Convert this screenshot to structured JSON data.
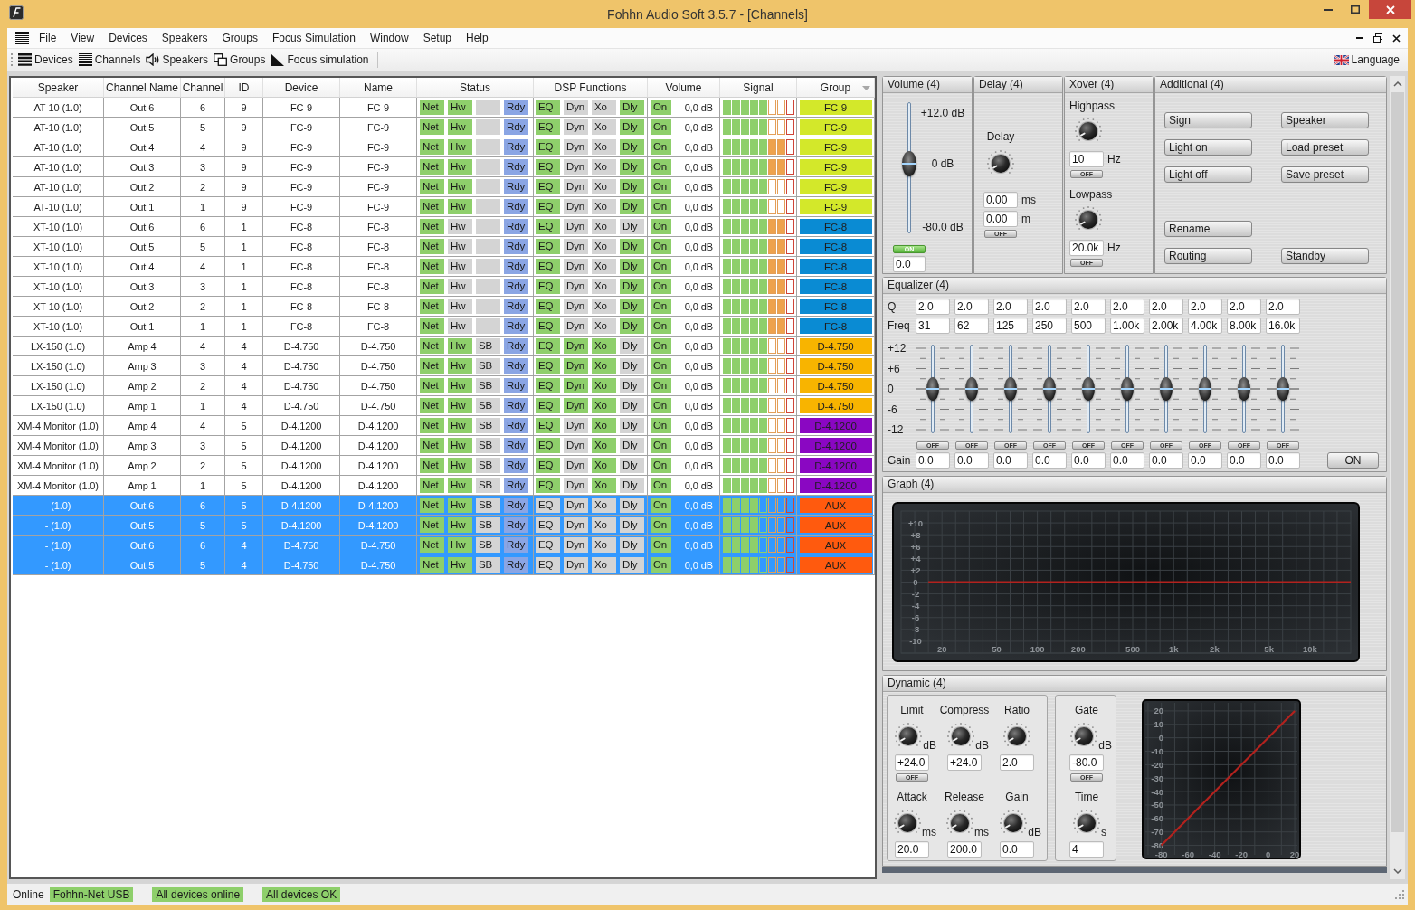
{
  "window": {
    "title": "Fohhn Audio Soft 3.5.7 - [Channels]"
  },
  "menu": {
    "items": [
      "File",
      "View",
      "Devices",
      "Speakers",
      "Groups",
      "Focus Simulation",
      "Window",
      "Setup",
      "Help"
    ]
  },
  "toolbar": {
    "items": [
      "Devices",
      "Channels",
      "Speakers",
      "Groups",
      "Focus simulation"
    ],
    "language": "Language"
  },
  "table": {
    "columns": [
      "Speaker",
      "Channel Name",
      "Channel",
      "ID",
      "Device",
      "Name",
      "Status",
      "DSP Functions",
      "Volume",
      "Signal",
      "Group"
    ],
    "rows": [
      {
        "speaker": "AT-10 (1.0)",
        "channel_name": "Out 6",
        "channel": "6",
        "id": "9",
        "device": "FC-9",
        "name": "FC-9",
        "status": [
          {
            "label": "Net",
            "on": true
          },
          {
            "label": "Hw",
            "on": true
          },
          {
            "on": false
          },
          {
            "label": "Rdy",
            "on": true
          }
        ],
        "dsp": [
          {
            "label": "EQ",
            "on": true
          },
          {
            "label": "Dyn",
            "on": false
          },
          {
            "label": "Xo",
            "on": false
          },
          {
            "label": "Dly",
            "on": true
          }
        ],
        "output": {
          "label": "On",
          "on": true
        },
        "volume": "0,0 dB",
        "signal": {
          "level": 0.625
        },
        "group": {
          "label": "FC-9",
          "color": "#d3e82a"
        },
        "selected": false
      },
      {
        "speaker": "AT-10 (1.0)",
        "channel_name": "Out 5",
        "channel": "5",
        "id": "9",
        "device": "FC-9",
        "name": "FC-9",
        "status": [
          {
            "label": "Net",
            "on": true
          },
          {
            "label": "Hw",
            "on": true
          },
          {
            "on": false
          },
          {
            "label": "Rdy",
            "on": true
          }
        ],
        "dsp": [
          {
            "label": "EQ",
            "on": true
          },
          {
            "label": "Dyn",
            "on": false
          },
          {
            "label": "Xo",
            "on": false
          },
          {
            "label": "Dly",
            "on": true
          }
        ],
        "output": {
          "label": "On",
          "on": true
        },
        "volume": "0,0 dB",
        "signal": {
          "level": 0.625
        },
        "group": {
          "label": "FC-9",
          "color": "#d3e82a"
        },
        "selected": false
      },
      {
        "speaker": "AT-10 (1.0)",
        "channel_name": "Out 4",
        "channel": "4",
        "id": "9",
        "device": "FC-9",
        "name": "FC-9",
        "status": [
          {
            "label": "Net",
            "on": true
          },
          {
            "label": "Hw",
            "on": true
          },
          {
            "on": false
          },
          {
            "label": "Rdy",
            "on": true
          }
        ],
        "dsp": [
          {
            "label": "EQ",
            "on": true
          },
          {
            "label": "Dyn",
            "on": false
          },
          {
            "label": "Xo",
            "on": false
          },
          {
            "label": "Dly",
            "on": true
          }
        ],
        "output": {
          "label": "On",
          "on": true
        },
        "volume": "0,0 dB",
        "signal": {
          "level": 0.875
        },
        "group": {
          "label": "FC-9",
          "color": "#d3e82a"
        },
        "selected": false
      },
      {
        "speaker": "AT-10 (1.0)",
        "channel_name": "Out 3",
        "channel": "3",
        "id": "9",
        "device": "FC-9",
        "name": "FC-9",
        "status": [
          {
            "label": "Net",
            "on": true
          },
          {
            "label": "Hw",
            "on": true
          },
          {
            "on": false
          },
          {
            "label": "Rdy",
            "on": true
          }
        ],
        "dsp": [
          {
            "label": "EQ",
            "on": true
          },
          {
            "label": "Dyn",
            "on": false
          },
          {
            "label": "Xo",
            "on": false
          },
          {
            "label": "Dly",
            "on": true
          }
        ],
        "output": {
          "label": "On",
          "on": true
        },
        "volume": "0,0 dB",
        "signal": {
          "level": 0.875
        },
        "group": {
          "label": "FC-9",
          "color": "#d3e82a"
        },
        "selected": false
      },
      {
        "speaker": "AT-10 (1.0)",
        "channel_name": "Out 2",
        "channel": "2",
        "id": "9",
        "device": "FC-9",
        "name": "FC-9",
        "status": [
          {
            "label": "Net",
            "on": true
          },
          {
            "label": "Hw",
            "on": true
          },
          {
            "on": false
          },
          {
            "label": "Rdy",
            "on": true
          }
        ],
        "dsp": [
          {
            "label": "EQ",
            "on": true
          },
          {
            "label": "Dyn",
            "on": false
          },
          {
            "label": "Xo",
            "on": false
          },
          {
            "label": "Dly",
            "on": true
          }
        ],
        "output": {
          "label": "On",
          "on": true
        },
        "volume": "0,0 dB",
        "signal": {
          "level": 0.625
        },
        "group": {
          "label": "FC-9",
          "color": "#d3e82a"
        },
        "selected": false
      },
      {
        "speaker": "AT-10 (1.0)",
        "channel_name": "Out 1",
        "channel": "1",
        "id": "9",
        "device": "FC-9",
        "name": "FC-9",
        "status": [
          {
            "label": "Net",
            "on": true
          },
          {
            "label": "Hw",
            "on": true
          },
          {
            "on": false
          },
          {
            "label": "Rdy",
            "on": true
          }
        ],
        "dsp": [
          {
            "label": "EQ",
            "on": true
          },
          {
            "label": "Dyn",
            "on": false
          },
          {
            "label": "Xo",
            "on": false
          },
          {
            "label": "Dly",
            "on": true
          }
        ],
        "output": {
          "label": "On",
          "on": true
        },
        "volume": "0,0 dB",
        "signal": {
          "level": 0.625
        },
        "group": {
          "label": "FC-9",
          "color": "#d3e82a"
        },
        "selected": false
      },
      {
        "speaker": "XT-10 (1.0)",
        "channel_name": "Out 6",
        "channel": "6",
        "id": "1",
        "device": "FC-8",
        "name": "FC-8",
        "status": [
          {
            "label": "Net",
            "on": true
          },
          {
            "label": "Hw",
            "on": false
          },
          {
            "on": false
          },
          {
            "label": "Rdy",
            "on": true
          }
        ],
        "dsp": [
          {
            "label": "EQ",
            "on": true
          },
          {
            "label": "Dyn",
            "on": false
          },
          {
            "label": "Xo",
            "on": false
          },
          {
            "label": "Dly",
            "on": false
          }
        ],
        "output": {
          "label": "On",
          "on": true
        },
        "volume": "0,0 dB",
        "signal": {
          "level": 0.875
        },
        "group": {
          "label": "FC-8",
          "color": "#0a8bd3"
        },
        "selected": false
      },
      {
        "speaker": "XT-10 (1.0)",
        "channel_name": "Out 5",
        "channel": "5",
        "id": "1",
        "device": "FC-8",
        "name": "FC-8",
        "status": [
          {
            "label": "Net",
            "on": true
          },
          {
            "label": "Hw",
            "on": false
          },
          {
            "on": false
          },
          {
            "label": "Rdy",
            "on": true
          }
        ],
        "dsp": [
          {
            "label": "EQ",
            "on": true
          },
          {
            "label": "Dyn",
            "on": false
          },
          {
            "label": "Xo",
            "on": false
          },
          {
            "label": "Dly",
            "on": true
          }
        ],
        "output": {
          "label": "On",
          "on": true
        },
        "volume": "0,0 dB",
        "signal": {
          "level": 0.875
        },
        "group": {
          "label": "FC-8",
          "color": "#0a8bd3"
        },
        "selected": false
      },
      {
        "speaker": "XT-10 (1.0)",
        "channel_name": "Out 4",
        "channel": "4",
        "id": "1",
        "device": "FC-8",
        "name": "FC-8",
        "status": [
          {
            "label": "Net",
            "on": true
          },
          {
            "label": "Hw",
            "on": false
          },
          {
            "on": false
          },
          {
            "label": "Rdy",
            "on": true
          }
        ],
        "dsp": [
          {
            "label": "EQ",
            "on": true
          },
          {
            "label": "Dyn",
            "on": false
          },
          {
            "label": "Xo",
            "on": false
          },
          {
            "label": "Dly",
            "on": true
          }
        ],
        "output": {
          "label": "On",
          "on": true
        },
        "volume": "0,0 dB",
        "signal": {
          "level": 0.875
        },
        "group": {
          "label": "FC-8",
          "color": "#0a8bd3"
        },
        "selected": false
      },
      {
        "speaker": "XT-10 (1.0)",
        "channel_name": "Out 3",
        "channel": "3",
        "id": "1",
        "device": "FC-8",
        "name": "FC-8",
        "status": [
          {
            "label": "Net",
            "on": true
          },
          {
            "label": "Hw",
            "on": false
          },
          {
            "on": false
          },
          {
            "label": "Rdy",
            "on": true
          }
        ],
        "dsp": [
          {
            "label": "EQ",
            "on": true
          },
          {
            "label": "Dyn",
            "on": false
          },
          {
            "label": "Xo",
            "on": false
          },
          {
            "label": "Dly",
            "on": true
          }
        ],
        "output": {
          "label": "On",
          "on": true
        },
        "volume": "0,0 dB",
        "signal": {
          "level": 0.875
        },
        "group": {
          "label": "FC-8",
          "color": "#0a8bd3"
        },
        "selected": false
      },
      {
        "speaker": "XT-10 (1.0)",
        "channel_name": "Out 2",
        "channel": "2",
        "id": "1",
        "device": "FC-8",
        "name": "FC-8",
        "status": [
          {
            "label": "Net",
            "on": true
          },
          {
            "label": "Hw",
            "on": false
          },
          {
            "on": false
          },
          {
            "label": "Rdy",
            "on": true
          }
        ],
        "dsp": [
          {
            "label": "EQ",
            "on": true
          },
          {
            "label": "Dyn",
            "on": false
          },
          {
            "label": "Xo",
            "on": false
          },
          {
            "label": "Dly",
            "on": true
          }
        ],
        "output": {
          "label": "On",
          "on": true
        },
        "volume": "0,0 dB",
        "signal": {
          "level": 0.875
        },
        "group": {
          "label": "FC-8",
          "color": "#0a8bd3"
        },
        "selected": false
      },
      {
        "speaker": "XT-10 (1.0)",
        "channel_name": "Out 1",
        "channel": "1",
        "id": "1",
        "device": "FC-8",
        "name": "FC-8",
        "status": [
          {
            "label": "Net",
            "on": true
          },
          {
            "label": "Hw",
            "on": false
          },
          {
            "on": false
          },
          {
            "label": "Rdy",
            "on": true
          }
        ],
        "dsp": [
          {
            "label": "EQ",
            "on": true
          },
          {
            "label": "Dyn",
            "on": false
          },
          {
            "label": "Xo",
            "on": false
          },
          {
            "label": "Dly",
            "on": true
          }
        ],
        "output": {
          "label": "On",
          "on": true
        },
        "volume": "0,0 dB",
        "signal": {
          "level": 0.875
        },
        "group": {
          "label": "FC-8",
          "color": "#0a8bd3"
        },
        "selected": false
      },
      {
        "speaker": "LX-150 (1.0)",
        "channel_name": "Amp 4",
        "channel": "4",
        "id": "4",
        "device": "D-4.750",
        "name": "D-4.750",
        "status": [
          {
            "label": "Net",
            "on": true
          },
          {
            "label": "Hw",
            "on": true
          },
          {
            "label": "SB",
            "on": false
          },
          {
            "label": "Rdy",
            "on": true
          }
        ],
        "dsp": [
          {
            "label": "EQ",
            "on": true
          },
          {
            "label": "Dyn",
            "on": true
          },
          {
            "label": "Xo",
            "on": true
          },
          {
            "label": "Dly",
            "on": false
          }
        ],
        "output": {
          "label": "On",
          "on": true
        },
        "volume": "0,0 dB",
        "signal": {
          "level": 0.625
        },
        "group": {
          "label": "D-4.750",
          "color": "#f8b400"
        },
        "selected": false
      },
      {
        "speaker": "LX-150 (1.0)",
        "channel_name": "Amp 3",
        "channel": "3",
        "id": "4",
        "device": "D-4.750",
        "name": "D-4.750",
        "status": [
          {
            "label": "Net",
            "on": true
          },
          {
            "label": "Hw",
            "on": true
          },
          {
            "label": "SB",
            "on": false
          },
          {
            "label": "Rdy",
            "on": true
          }
        ],
        "dsp": [
          {
            "label": "EQ",
            "on": true
          },
          {
            "label": "Dyn",
            "on": true
          },
          {
            "label": "Xo",
            "on": true
          },
          {
            "label": "Dly",
            "on": false
          }
        ],
        "output": {
          "label": "On",
          "on": true
        },
        "volume": "0,0 dB",
        "signal": {
          "level": 0.625
        },
        "group": {
          "label": "D-4.750",
          "color": "#f8b400"
        },
        "selected": false
      },
      {
        "speaker": "LX-150 (1.0)",
        "channel_name": "Amp 2",
        "channel": "2",
        "id": "4",
        "device": "D-4.750",
        "name": "D-4.750",
        "status": [
          {
            "label": "Net",
            "on": true
          },
          {
            "label": "Hw",
            "on": true
          },
          {
            "label": "SB",
            "on": false
          },
          {
            "label": "Rdy",
            "on": true
          }
        ],
        "dsp": [
          {
            "label": "EQ",
            "on": true
          },
          {
            "label": "Dyn",
            "on": true
          },
          {
            "label": "Xo",
            "on": true
          },
          {
            "label": "Dly",
            "on": false
          }
        ],
        "output": {
          "label": "On",
          "on": true
        },
        "volume": "0,0 dB",
        "signal": {
          "level": 0.625
        },
        "group": {
          "label": "D-4.750",
          "color": "#f8b400"
        },
        "selected": false
      },
      {
        "speaker": "LX-150 (1.0)",
        "channel_name": "Amp 1",
        "channel": "1",
        "id": "4",
        "device": "D-4.750",
        "name": "D-4.750",
        "status": [
          {
            "label": "Net",
            "on": true
          },
          {
            "label": "Hw",
            "on": true
          },
          {
            "label": "SB",
            "on": false
          },
          {
            "label": "Rdy",
            "on": true
          }
        ],
        "dsp": [
          {
            "label": "EQ",
            "on": true
          },
          {
            "label": "Dyn",
            "on": true
          },
          {
            "label": "Xo",
            "on": true
          },
          {
            "label": "Dly",
            "on": false
          }
        ],
        "output": {
          "label": "On",
          "on": true
        },
        "volume": "0,0 dB",
        "signal": {
          "level": 0.625
        },
        "group": {
          "label": "D-4.750",
          "color": "#f8b400"
        },
        "selected": false
      },
      {
        "speaker": "XM-4 Monitor (1.0)",
        "channel_name": "Amp 4",
        "channel": "4",
        "id": "5",
        "device": "D-4.1200",
        "name": "D-4.1200",
        "status": [
          {
            "label": "Net",
            "on": true
          },
          {
            "label": "Hw",
            "on": true
          },
          {
            "label": "SB",
            "on": false
          },
          {
            "label": "Rdy",
            "on": true
          }
        ],
        "dsp": [
          {
            "label": "EQ",
            "on": true
          },
          {
            "label": "Dyn",
            "on": false
          },
          {
            "label": "Xo",
            "on": true
          },
          {
            "label": "Dly",
            "on": false
          }
        ],
        "output": {
          "label": "On",
          "on": true
        },
        "volume": "0,0 dB",
        "signal": {
          "level": 0.625
        },
        "group": {
          "label": "D-4.1200",
          "color": "#8a07c2"
        },
        "selected": false
      },
      {
        "speaker": "XM-4 Monitor (1.0)",
        "channel_name": "Amp 3",
        "channel": "3",
        "id": "5",
        "device": "D-4.1200",
        "name": "D-4.1200",
        "status": [
          {
            "label": "Net",
            "on": true
          },
          {
            "label": "Hw",
            "on": true
          },
          {
            "label": "SB",
            "on": false
          },
          {
            "label": "Rdy",
            "on": true
          }
        ],
        "dsp": [
          {
            "label": "EQ",
            "on": true
          },
          {
            "label": "Dyn",
            "on": false
          },
          {
            "label": "Xo",
            "on": true
          },
          {
            "label": "Dly",
            "on": false
          }
        ],
        "output": {
          "label": "On",
          "on": true
        },
        "volume": "0,0 dB",
        "signal": {
          "level": 0.625
        },
        "group": {
          "label": "D-4.1200",
          "color": "#8a07c2"
        },
        "selected": false
      },
      {
        "speaker": "XM-4 Monitor (1.0)",
        "channel_name": "Amp 2",
        "channel": "2",
        "id": "5",
        "device": "D-4.1200",
        "name": "D-4.1200",
        "status": [
          {
            "label": "Net",
            "on": true
          },
          {
            "label": "Hw",
            "on": true
          },
          {
            "label": "SB",
            "on": false
          },
          {
            "label": "Rdy",
            "on": true
          }
        ],
        "dsp": [
          {
            "label": "EQ",
            "on": true
          },
          {
            "label": "Dyn",
            "on": false
          },
          {
            "label": "Xo",
            "on": true
          },
          {
            "label": "Dly",
            "on": false
          }
        ],
        "output": {
          "label": "On",
          "on": true
        },
        "volume": "0,0 dB",
        "signal": {
          "level": 0.625
        },
        "group": {
          "label": "D-4.1200",
          "color": "#8a07c2"
        },
        "selected": false
      },
      {
        "speaker": "XM-4 Monitor (1.0)",
        "channel_name": "Amp 1",
        "channel": "1",
        "id": "5",
        "device": "D-4.1200",
        "name": "D-4.1200",
        "status": [
          {
            "label": "Net",
            "on": true
          },
          {
            "label": "Hw",
            "on": true
          },
          {
            "label": "SB",
            "on": false
          },
          {
            "label": "Rdy",
            "on": true
          }
        ],
        "dsp": [
          {
            "label": "EQ",
            "on": true
          },
          {
            "label": "Dyn",
            "on": false
          },
          {
            "label": "Xo",
            "on": true
          },
          {
            "label": "Dly",
            "on": false
          }
        ],
        "output": {
          "label": "On",
          "on": true
        },
        "volume": "0,0 dB",
        "signal": {
          "level": 0.625
        },
        "group": {
          "label": "D-4.1200",
          "color": "#8a07c2"
        },
        "selected": false
      },
      {
        "speaker": "- (1.0)",
        "channel_name": "Out 6",
        "channel": "6",
        "id": "5",
        "device": "D-4.1200",
        "name": "D-4.1200",
        "status": [
          {
            "label": "Net",
            "on": true
          },
          {
            "label": "Hw",
            "on": true
          },
          {
            "label": "SB",
            "on": false
          },
          {
            "label": "Rdy",
            "on": true
          }
        ],
        "dsp": [
          {
            "label": "EQ",
            "on": false
          },
          {
            "label": "Dyn",
            "on": false
          },
          {
            "label": "Xo",
            "on": false
          },
          {
            "label": "Dly",
            "on": false
          }
        ],
        "output": {
          "label": "On",
          "on": true
        },
        "volume": "0,0 dB",
        "signal": {
          "level": 0.5
        },
        "group": {
          "label": "AUX",
          "color": "#ff5a0e"
        },
        "selected": true
      },
      {
        "speaker": "- (1.0)",
        "channel_name": "Out 5",
        "channel": "5",
        "id": "5",
        "device": "D-4.1200",
        "name": "D-4.1200",
        "status": [
          {
            "label": "Net",
            "on": true
          },
          {
            "label": "Hw",
            "on": true
          },
          {
            "label": "SB",
            "on": false
          },
          {
            "label": "Rdy",
            "on": true
          }
        ],
        "dsp": [
          {
            "label": "EQ",
            "on": false
          },
          {
            "label": "Dyn",
            "on": false
          },
          {
            "label": "Xo",
            "on": false
          },
          {
            "label": "Dly",
            "on": false
          }
        ],
        "output": {
          "label": "On",
          "on": true
        },
        "volume": "0,0 dB",
        "signal": {
          "level": 0.5
        },
        "group": {
          "label": "AUX",
          "color": "#ff5a0e"
        },
        "selected": true
      },
      {
        "speaker": "- (1.0)",
        "channel_name": "Out 6",
        "channel": "6",
        "id": "4",
        "device": "D-4.750",
        "name": "D-4.750",
        "status": [
          {
            "label": "Net",
            "on": true
          },
          {
            "label": "Hw",
            "on": true
          },
          {
            "label": "SB",
            "on": false
          },
          {
            "label": "Rdy",
            "on": true
          }
        ],
        "dsp": [
          {
            "label": "EQ",
            "on": false
          },
          {
            "label": "Dyn",
            "on": false
          },
          {
            "label": "Xo",
            "on": false
          },
          {
            "label": "Dly",
            "on": false
          }
        ],
        "output": {
          "label": "On",
          "on": true
        },
        "volume": "0,0 dB",
        "signal": {
          "level": 0.5
        },
        "group": {
          "label": "AUX",
          "color": "#ff5a0e"
        },
        "selected": true
      },
      {
        "speaker": "- (1.0)",
        "channel_name": "Out 5",
        "channel": "5",
        "id": "4",
        "device": "D-4.750",
        "name": "D-4.750",
        "status": [
          {
            "label": "Net",
            "on": true
          },
          {
            "label": "Hw",
            "on": true
          },
          {
            "label": "SB",
            "on": false
          },
          {
            "label": "Rdy",
            "on": true
          }
        ],
        "dsp": [
          {
            "label": "EQ",
            "on": false
          },
          {
            "label": "Dyn",
            "on": false
          },
          {
            "label": "Xo",
            "on": false
          },
          {
            "label": "Dly",
            "on": false
          }
        ],
        "output": {
          "label": "On",
          "on": true
        },
        "volume": "0,0 dB",
        "signal": {
          "level": 0.5
        },
        "group": {
          "label": "AUX",
          "color": "#ff5a0e"
        },
        "selected": true
      }
    ]
  },
  "volume_panel": {
    "title": "Volume (4)",
    "scale": [
      "+12.0 dB",
      "0 dB",
      "-80.0 dB"
    ],
    "level": 0.53,
    "toggle": {
      "label": "ON",
      "on": true
    },
    "value": "0.0"
  },
  "delay_panel": {
    "title": "Delay (4)",
    "label": "Delay",
    "fields": [
      {
        "value": "0.00",
        "unit": "ms"
      },
      {
        "value": "0.00",
        "unit": "m"
      }
    ],
    "toggle": {
      "label": "OFF",
      "on": false
    }
  },
  "xover_panel": {
    "title": "Xover (4)",
    "filters": [
      {
        "label": "Highpass",
        "value": "10",
        "unit": "Hz",
        "toggle": {
          "label": "OFF",
          "on": false
        }
      },
      {
        "label": "Lowpass",
        "value": "20.0k",
        "unit": "Hz",
        "toggle": {
          "label": "OFF",
          "on": false
        }
      }
    ]
  },
  "additional_panel": {
    "title": "Additional (4)",
    "button_groups": [
      [
        [
          "Sign",
          "Speaker"
        ],
        [
          "Light on",
          "Load preset"
        ],
        [
          "Light off",
          "Save preset"
        ]
      ],
      [
        [
          "Rename"
        ],
        [
          "Routing",
          "Standby"
        ]
      ]
    ]
  },
  "equalizer": {
    "title": "Equalizer (4)",
    "q_label": "Q",
    "freq_label": "Freq",
    "gain_label": "Gain",
    "scale": [
      "+12",
      "+6",
      "0",
      "-6",
      "-12"
    ],
    "bands": [
      {
        "q": "2.0",
        "freq": "31",
        "level": 0.5,
        "toggle": {
          "label": "OFF",
          "on": false
        },
        "gain": "0.0"
      },
      {
        "q": "2.0",
        "freq": "62",
        "level": 0.5,
        "toggle": {
          "label": "OFF",
          "on": false
        },
        "gain": "0.0"
      },
      {
        "q": "2.0",
        "freq": "125",
        "level": 0.5,
        "toggle": {
          "label": "OFF",
          "on": false
        },
        "gain": "0.0"
      },
      {
        "q": "2.0",
        "freq": "250",
        "level": 0.5,
        "toggle": {
          "label": "OFF",
          "on": false
        },
        "gain": "0.0"
      },
      {
        "q": "2.0",
        "freq": "500",
        "level": 0.5,
        "toggle": {
          "label": "OFF",
          "on": false
        },
        "gain": "0.0"
      },
      {
        "q": "2.0",
        "freq": "1.00k",
        "level": 0.5,
        "toggle": {
          "label": "OFF",
          "on": false
        },
        "gain": "0.0"
      },
      {
        "q": "2.0",
        "freq": "2.00k",
        "level": 0.5,
        "toggle": {
          "label": "OFF",
          "on": false
        },
        "gain": "0.0"
      },
      {
        "q": "2.0",
        "freq": "4.00k",
        "level": 0.5,
        "toggle": {
          "label": "OFF",
          "on": false
        },
        "gain": "0.0"
      },
      {
        "q": "2.0",
        "freq": "8.00k",
        "level": 0.5,
        "toggle": {
          "label": "OFF",
          "on": false
        },
        "gain": "0.0"
      },
      {
        "q": "2.0",
        "freq": "16.0k",
        "level": 0.5,
        "toggle": {
          "label": "OFF",
          "on": false
        },
        "gain": "0.0"
      }
    ],
    "button": "ON"
  },
  "graph": {
    "title": "Graph (4)",
    "chart_data": {
      "type": "line",
      "grid": true,
      "categories": [
        null,
        null,
        null,
        "20",
        null,
        null,
        null,
        "50",
        null,
        null,
        "100",
        null,
        null,
        "200",
        null,
        null,
        null,
        "500",
        null,
        null,
        "1k",
        null,
        null,
        "2k",
        null,
        null,
        null,
        "5k",
        null,
        null,
        "10k",
        null,
        null,
        null
      ],
      "ylim": [
        -12,
        12
      ],
      "yticks": [
        {
          "value": 10,
          "label": "+10"
        },
        {
          "value": 8,
          "label": "+8"
        },
        {
          "value": 6,
          "label": "+6"
        },
        {
          "value": 4,
          "label": "+4"
        },
        {
          "value": 2,
          "label": "+2"
        },
        0,
        -2,
        -4,
        -6,
        -8,
        -10
      ],
      "series": [
        {
          "color": "#b3221e",
          "values": [
            null,
            null,
            0,
            0,
            0,
            0,
            0,
            0,
            0,
            0,
            0,
            0,
            0,
            0,
            0,
            0,
            0,
            0,
            0,
            0,
            0,
            0,
            0,
            0,
            0,
            0,
            0,
            0,
            0,
            0,
            0,
            0,
            0,
            0
          ]
        }
      ]
    }
  },
  "dynamic": {
    "title": "Dynamic (4)",
    "compressor": [
      {
        "label": "Limit",
        "unit": "dB",
        "value": "+24.0",
        "toggle": {
          "label": "OFF",
          "on": false
        }
      },
      {
        "label": "Compress",
        "unit": "dB",
        "value": "+24.0"
      },
      {
        "label": "Ratio",
        "value": "2.0"
      },
      {
        "label": "Attack",
        "unit": "ms",
        "value": "20.0"
      },
      {
        "label": "Release",
        "unit": "ms",
        "value": "200.0"
      },
      {
        "label": "Gain",
        "unit": "dB",
        "value": "0.0"
      }
    ],
    "gate": [
      {
        "label": "Gate",
        "unit": "dB",
        "value": "-80.0",
        "toggle": {
          "label": "OFF",
          "on": false
        }
      },
      {
        "label": "Time",
        "unit": "s",
        "value": "4"
      }
    ],
    "chart_data": {
      "type": "line",
      "grid": true,
      "xlim": [
        -92,
        22
      ],
      "ylim": [
        -87,
        26
      ],
      "xticks": [
        -80,
        -60,
        -40,
        -20,
        0,
        20
      ],
      "yticks": [
        20,
        10,
        0,
        -10,
        -20,
        -30,
        -40,
        -50,
        -60,
        -70,
        -80
      ],
      "x": [
        -80,
        20
      ],
      "series": [
        {
          "color": "#b3221e",
          "values": [
            -80,
            20
          ]
        }
      ]
    }
  },
  "status_bar": {
    "state": "Online",
    "indicators": [
      "Fohhn-Net USB",
      "All devices online",
      "All devices OK"
    ]
  }
}
